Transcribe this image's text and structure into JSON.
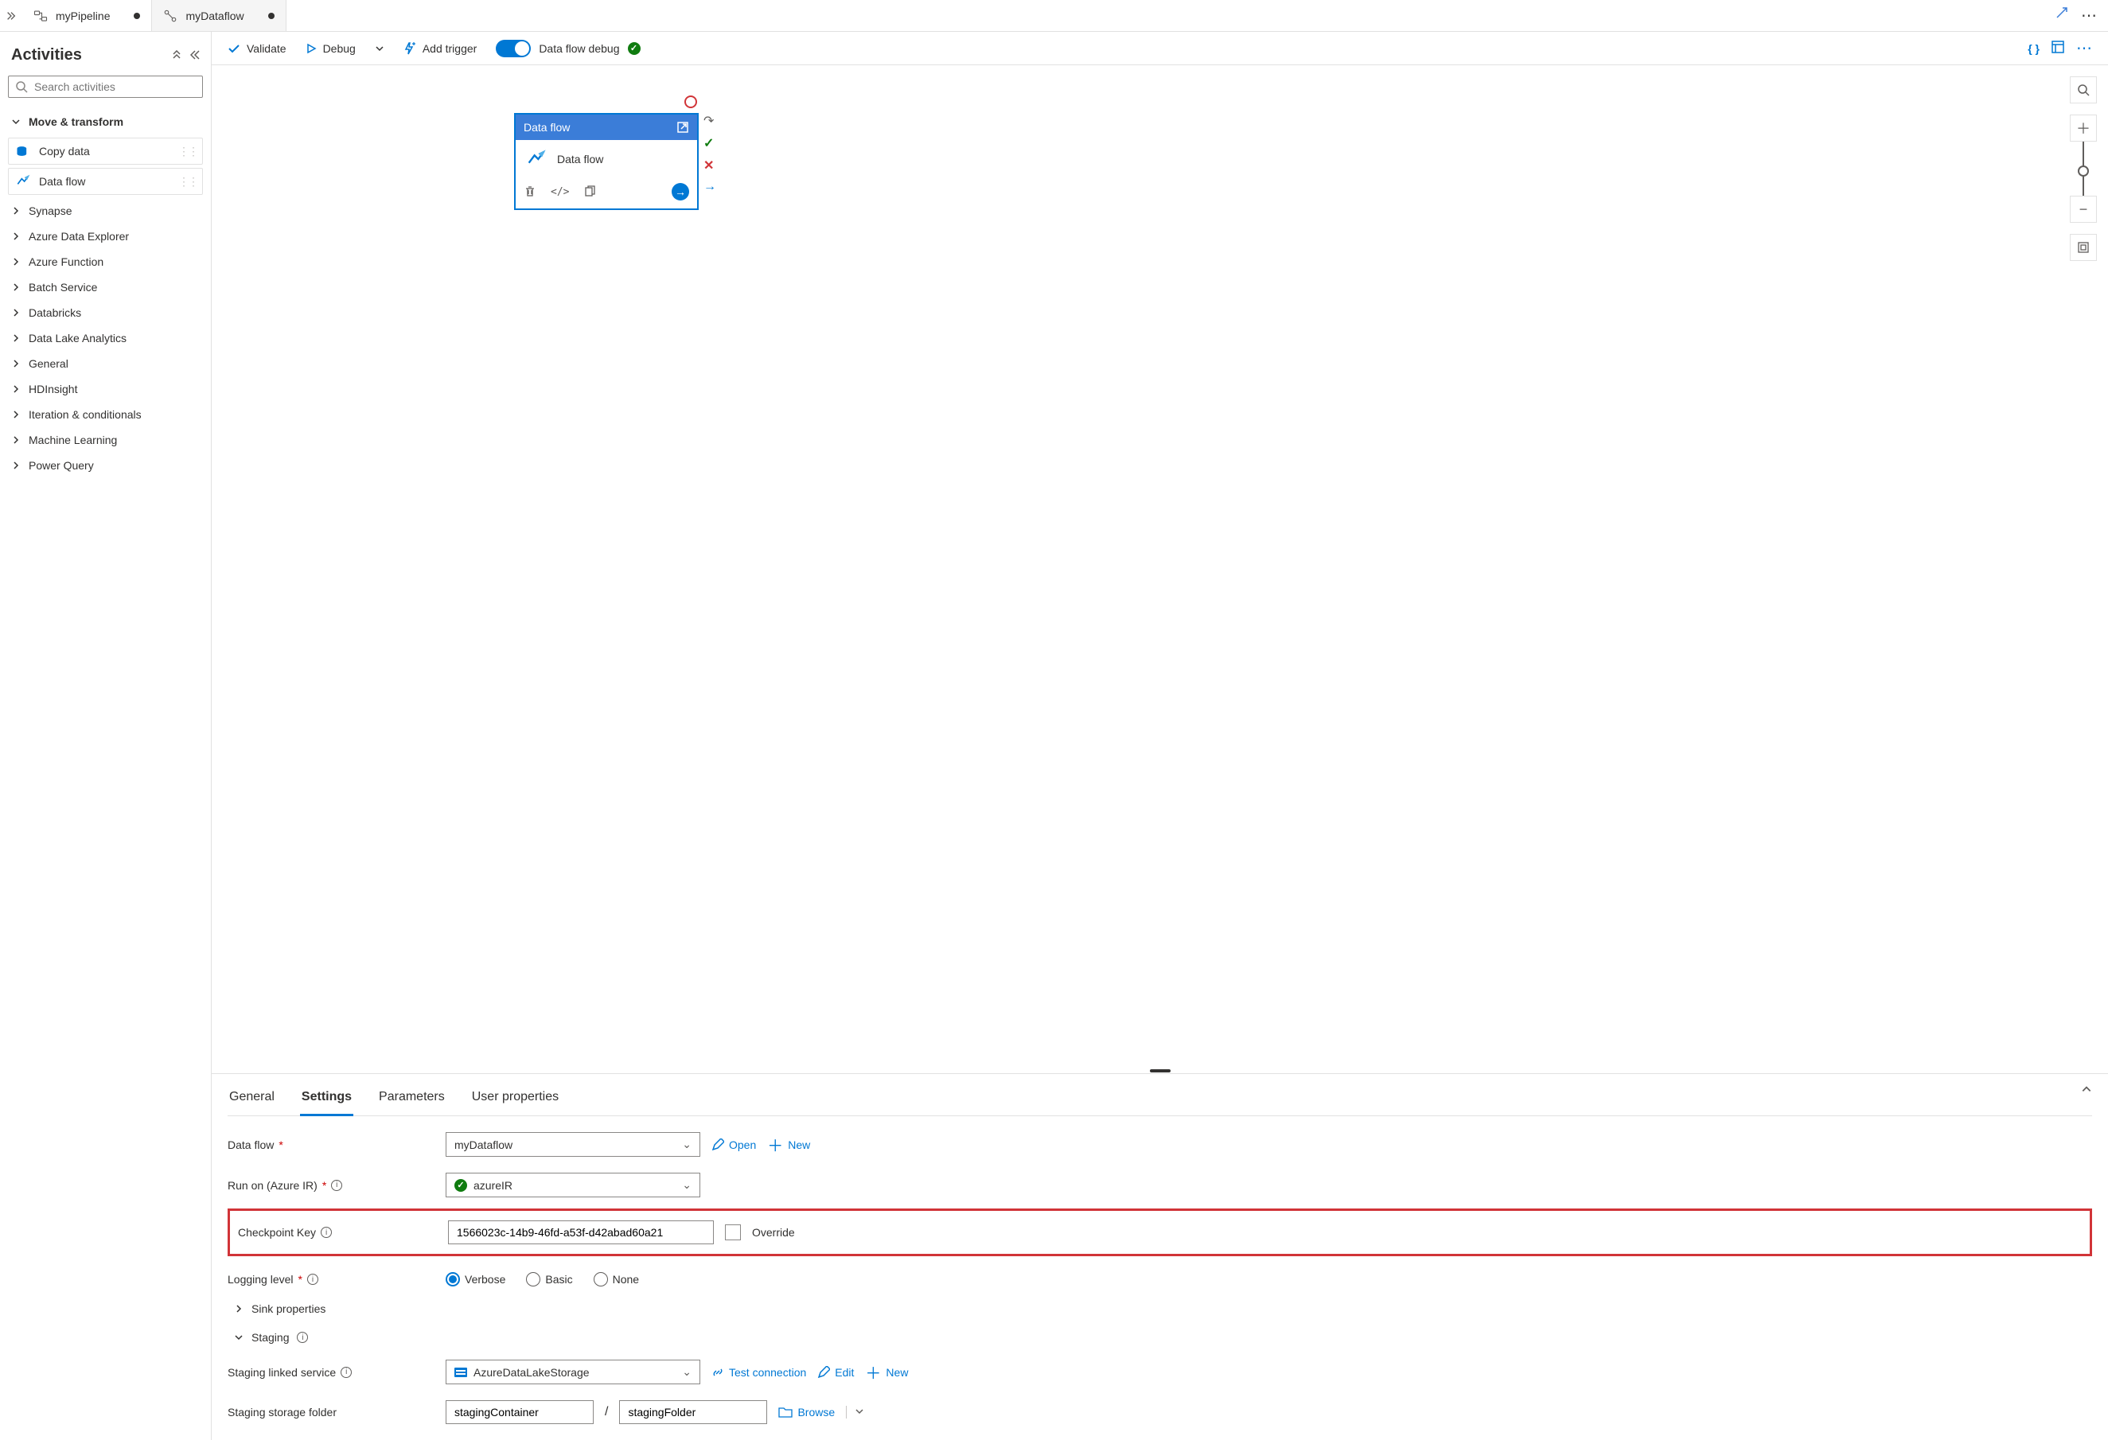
{
  "tabs": [
    {
      "label": "myPipeline",
      "modified": true,
      "active": true
    },
    {
      "label": "myDataflow",
      "modified": true,
      "active": false
    }
  ],
  "sidebar": {
    "title": "Activities",
    "search_placeholder": "Search activities",
    "categories": [
      {
        "label": "Move & transform",
        "expanded": true,
        "items": [
          {
            "label": "Copy data"
          },
          {
            "label": "Data flow"
          }
        ]
      },
      {
        "label": "Synapse",
        "expanded": false
      },
      {
        "label": "Azure Data Explorer",
        "expanded": false
      },
      {
        "label": "Azure Function",
        "expanded": false
      },
      {
        "label": "Batch Service",
        "expanded": false
      },
      {
        "label": "Databricks",
        "expanded": false
      },
      {
        "label": "Data Lake Analytics",
        "expanded": false
      },
      {
        "label": "General",
        "expanded": false
      },
      {
        "label": "HDInsight",
        "expanded": false
      },
      {
        "label": "Iteration & conditionals",
        "expanded": false
      },
      {
        "label": "Machine Learning",
        "expanded": false
      },
      {
        "label": "Power Query",
        "expanded": false
      }
    ]
  },
  "toolbar": {
    "validate": "Validate",
    "debug": "Debug",
    "add_trigger": "Add trigger",
    "debug_label": "Data flow debug"
  },
  "node": {
    "header": "Data flow",
    "title": "Data flow"
  },
  "prop_tabs": [
    "General",
    "Settings",
    "Parameters",
    "User properties"
  ],
  "prop_selected": "Settings",
  "settings": {
    "dataflow_label": "Data flow",
    "dataflow_value": "myDataflow",
    "open": "Open",
    "new": "New",
    "runon_label": "Run on (Azure IR)",
    "runon_value": "azureIR",
    "checkpoint_label": "Checkpoint Key",
    "checkpoint_value": "1566023c-14b9-46fd-a53f-d42abad60a21",
    "override_label": "Override",
    "logging_label": "Logging level",
    "logging_options": [
      "Verbose",
      "Basic",
      "None"
    ],
    "sink_properties": "Sink properties",
    "staging": "Staging",
    "staging_linked_label": "Staging linked service",
    "staging_linked_value": "AzureDataLakeStorage",
    "test_connection": "Test connection",
    "edit": "Edit",
    "staging_folder_label": "Staging storage folder",
    "staging_container": "stagingContainer",
    "staging_folder": "stagingFolder",
    "browse": "Browse"
  }
}
